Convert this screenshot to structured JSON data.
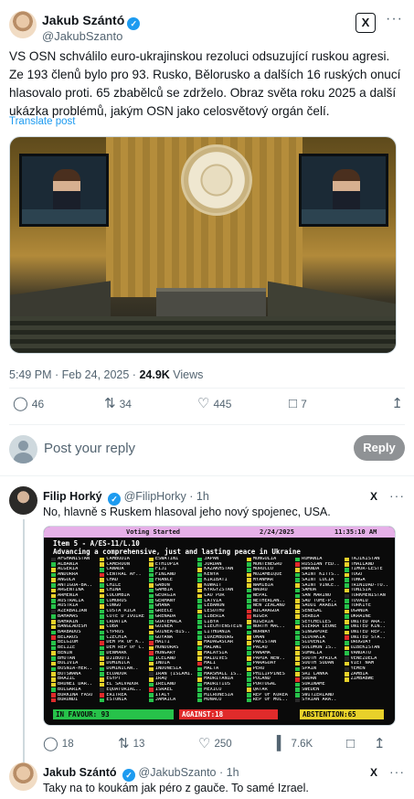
{
  "post": {
    "author_name": "Jakub Szántó",
    "author_handle": "@JakubSzanto",
    "grok_label": "X",
    "more_label": "···",
    "verified_mark": "✓",
    "text": "VS OSN schválilo euro-ukrajinskou rezoluci odsuzující ruskou agresi. Ze 193 členů bylo pro 93. Rusko, Bělorusko a dalších 16 ruských onucí hlasovalo proti. 65 zbabělců se zdrželo. Obraz světa roku 2025 a další ukázka problémů, jakým OSN jako celosvětový orgán čelí.",
    "translate_label": "Translate post",
    "time": "5:49 PM · Feb 24, 2025 ·",
    "views_count": "24.9K",
    "views_label": "Views",
    "stats": {
      "replies": "46",
      "reposts": "34",
      "likes": "445",
      "bookmarks": "7"
    }
  },
  "reply_box": {
    "placeholder": "Post your reply",
    "button_label": "Reply"
  },
  "replies": [
    {
      "author_name": "Filip Horký",
      "author_handle": "@FilipHorky · 1h",
      "text": "No, hlavně s Ruskem hlasoval jeho nový spojenec, USA.",
      "stats": {
        "replies": "18",
        "reposts": "13",
        "likes": "250",
        "views": "7.6K"
      }
    },
    {
      "author_name": "Jakub Szántó",
      "author_handle": "@JakubSzanto · 1h",
      "text": "Taky na to koukám jak péro z gauče. To samé Izrael."
    }
  ],
  "vote_board": {
    "header_status": "Voting Started",
    "header_date": "2/24/2025",
    "header_time": "11:35:10 AM",
    "item": "Item 5 - A/ES-11/L.10",
    "title": "Advancing a comprehensive, just and lasting peace in Ukraine",
    "in_favour": "IN FAVOUR: 93",
    "against": "AGAINST:18",
    "abstention": "ABSTENTION:65",
    "countries": [
      [
        "AFGHANISTAN",
        "n"
      ],
      [
        "ALBANIA",
        "g"
      ],
      [
        "ALGERIA",
        "y"
      ],
      [
        "ANDORRA",
        "g"
      ],
      [
        "ANGOLA",
        "y"
      ],
      [
        "ANTIGUA-BA..",
        "g"
      ],
      [
        "ARGENTINA",
        "y"
      ],
      [
        "ARMENIA",
        "y"
      ],
      [
        "AUSTRALIA",
        "g"
      ],
      [
        "AUSTRIA",
        "g"
      ],
      [
        "AZERBAIJAN",
        "n"
      ],
      [
        "BAHAMAS",
        "g"
      ],
      [
        "BAHRAIN",
        "y"
      ],
      [
        "BANGLADESH",
        "y"
      ],
      [
        "BARBADOS",
        "g"
      ],
      [
        "BELARUS",
        "r"
      ],
      [
        "BELGIUM",
        "g"
      ],
      [
        "BELIZE",
        "g"
      ],
      [
        "BENIN",
        "y"
      ],
      [
        "BHUTAN",
        "g"
      ],
      [
        "BOLIVIA",
        "y"
      ],
      [
        "BOSNIA-HER..",
        "g"
      ],
      [
        "BOTSWANA",
        "y"
      ],
      [
        "BRAZIL",
        "y"
      ],
      [
        "BRUNEI DAR..",
        "y"
      ],
      [
        "BULGARIA",
        "g"
      ],
      [
        "BURKINA FASO",
        "r"
      ],
      [
        "BURUNDI",
        "r"
      ],
      [
        "CAMBODIA",
        "y"
      ],
      [
        "CAMEROON",
        "y"
      ],
      [
        "CANADA",
        "g"
      ],
      [
        "CENTRAL AF..",
        "r"
      ],
      [
        "CHAD",
        "y"
      ],
      [
        "CHILE",
        "g"
      ],
      [
        "CHINA",
        "y"
      ],
      [
        "COLOMBIA",
        "y"
      ],
      [
        "COMOROS",
        "g"
      ],
      [
        "CONGO",
        "y"
      ],
      [
        "COSTA RICA",
        "g"
      ],
      [
        "COTE D'IVOIRE",
        "g"
      ],
      [
        "CROATIA",
        "g"
      ],
      [
        "CUBA",
        "y"
      ],
      [
        "CYPRUS",
        "g"
      ],
      [
        "CZECHIA",
        "g"
      ],
      [
        "DEM PR OF K..",
        "r"
      ],
      [
        "DEM REP OF C..",
        "g"
      ],
      [
        "DENMARK",
        "g"
      ],
      [
        "DJIBOUTI",
        "y"
      ],
      [
        "DOMINICA",
        "y"
      ],
      [
        "DOMINICAN..",
        "g"
      ],
      [
        "ECUADOR",
        "g"
      ],
      [
        "EGYPT",
        "y"
      ],
      [
        "EL SALVADOR",
        "y"
      ],
      [
        "EQUATORIAL..",
        "n"
      ],
      [
        "ERITREA",
        "r"
      ],
      [
        "ESTONIA",
        "g"
      ],
      [
        "ESWATINI",
        "y"
      ],
      [
        "ETHIOPIA",
        "y"
      ],
      [
        "FIJI",
        "g"
      ],
      [
        "FINLAND",
        "g"
      ],
      [
        "FRANCE",
        "g"
      ],
      [
        "GABON",
        "y"
      ],
      [
        "GAMBIA",
        "g"
      ],
      [
        "GEORGIA",
        "g"
      ],
      [
        "GERMANY",
        "g"
      ],
      [
        "GHANA",
        "g"
      ],
      [
        "GREECE",
        "g"
      ],
      [
        "GRENADA",
        "g"
      ],
      [
        "GUATEMALA",
        "g"
      ],
      [
        "GUINEA",
        "y"
      ],
      [
        "GUINEA-BIS..",
        "y"
      ],
      [
        "GUYANA",
        "g"
      ],
      [
        "HAITI",
        "r"
      ],
      [
        "HONDURAS",
        "y"
      ],
      [
        "HUNGARY",
        "r"
      ],
      [
        "ICELAND",
        "g"
      ],
      [
        "INDIA",
        "y"
      ],
      [
        "INDONESIA",
        "y"
      ],
      [
        "IRAN (ISLAMI..",
        "n"
      ],
      [
        "IRAQ",
        "y"
      ],
      [
        "IRELAND",
        "g"
      ],
      [
        "ISRAEL",
        "r"
      ],
      [
        "ITALY",
        "g"
      ],
      [
        "JAMAICA",
        "g"
      ],
      [
        "JAPAN",
        "g"
      ],
      [
        "JORDAN",
        "g"
      ],
      [
        "KAZAKHSTAN",
        "y"
      ],
      [
        "KENYA",
        "g"
      ],
      [
        "KIRIBATI",
        "g"
      ],
      [
        "KUWAIT",
        "y"
      ],
      [
        "KYRGYZSTAN",
        "y"
      ],
      [
        "LAO PDR",
        "y"
      ],
      [
        "LATVIA",
        "g"
      ],
      [
        "LEBANON",
        "g"
      ],
      [
        "LESOTHO",
        "y"
      ],
      [
        "LIBERIA",
        "g"
      ],
      [
        "LIBYA",
        "g"
      ],
      [
        "LIECHTENSTEIN",
        "g"
      ],
      [
        "LITHUANIA",
        "g"
      ],
      [
        "LUXEMBOURG",
        "g"
      ],
      [
        "MADAGASCAR",
        "y"
      ],
      [
        "MALAWI",
        "g"
      ],
      [
        "MALAYSIA",
        "y"
      ],
      [
        "MALDIVES",
        "y"
      ],
      [
        "MALI",
        "r"
      ],
      [
        "MALTA",
        "g"
      ],
      [
        "MARSHALL IS..",
        "g"
      ],
      [
        "MAURITANIA",
        "y"
      ],
      [
        "MAURITIUS",
        "g"
      ],
      [
        "MEXICO",
        "g"
      ],
      [
        "MICRONESIA",
        "g"
      ],
      [
        "MONACO",
        "g"
      ],
      [
        "MONGOLIA",
        "y"
      ],
      [
        "MONTENEGRO",
        "g"
      ],
      [
        "MOROCCO",
        "g"
      ],
      [
        "MOZAMBIQUE",
        "y"
      ],
      [
        "MYANMAR",
        "y"
      ],
      [
        "NAMIBIA",
        "y"
      ],
      [
        "NAURU",
        "g"
      ],
      [
        "NEPAL",
        "g"
      ],
      [
        "NETHERLAN..",
        "g"
      ],
      [
        "NEW ZEALAND",
        "g"
      ],
      [
        "NICARAGUA",
        "r"
      ],
      [
        "NIGER",
        "r"
      ],
      [
        "NIGERIA",
        "y"
      ],
      [
        "NORTH MAC..",
        "g"
      ],
      [
        "NORWAY",
        "g"
      ],
      [
        "OMAN",
        "y"
      ],
      [
        "PAKISTAN",
        "y"
      ],
      [
        "PALAU",
        "g"
      ],
      [
        "PANAMA",
        "g"
      ],
      [
        "PAPUA NEW..",
        "y"
      ],
      [
        "PARAGUAY",
        "g"
      ],
      [
        "PERU",
        "y"
      ],
      [
        "PHILIPPINES",
        "g"
      ],
      [
        "POLAND",
        "g"
      ],
      [
        "PORTUGAL",
        "g"
      ],
      [
        "QATAR",
        "y"
      ],
      [
        "REP OF KOREA",
        "g"
      ],
      [
        "REP OF MOL..",
        "g"
      ],
      [
        "ROMANIA",
        "g"
      ],
      [
        "RUSSIAN FED..",
        "r"
      ],
      [
        "RWANDA",
        "y"
      ],
      [
        "SAINT KITTS..",
        "g"
      ],
      [
        "SAINT LUCIA",
        "g"
      ],
      [
        "SAINT VINCE..",
        "y"
      ],
      [
        "SAMOA",
        "g"
      ],
      [
        "SAN MARINO",
        "g"
      ],
      [
        "SAO TOME-P..",
        "y"
      ],
      [
        "SAUDI ARABIA",
        "y"
      ],
      [
        "SENEGAL",
        "y"
      ],
      [
        "SERBIA",
        "y"
      ],
      [
        "SEYCHELLES",
        "g"
      ],
      [
        "SIERRA LEONE",
        "y"
      ],
      [
        "SINGAPORE",
        "g"
      ],
      [
        "SLOVAKIA",
        "g"
      ],
      [
        "SLOVENIA",
        "g"
      ],
      [
        "SOLOMON IS..",
        "y"
      ],
      [
        "SOMALIA",
        "y"
      ],
      [
        "SOUTH AFRICA",
        "y"
      ],
      [
        "SOUTH SUDAN",
        "y"
      ],
      [
        "SPAIN",
        "g"
      ],
      [
        "SRI LANKA",
        "y"
      ],
      [
        "SUDAN",
        "r"
      ],
      [
        "SURINAME",
        "g"
      ],
      [
        "SWEDEN",
        "g"
      ],
      [
        "SWITZERLAND",
        "g"
      ],
      [
        "SYRIAN ARA..",
        "n"
      ],
      [
        "TAJIKISTAN",
        "y"
      ],
      [
        "THAILAND",
        "y"
      ],
      [
        "TIMOR-LESTE",
        "g"
      ],
      [
        "TOGO",
        "y"
      ],
      [
        "TONGA",
        "g"
      ],
      [
        "TRINIDAD-TO..",
        "g"
      ],
      [
        "TUNISIA",
        "y"
      ],
      [
        "TURKMENISTAN",
        "n"
      ],
      [
        "TUVALU",
        "g"
      ],
      [
        "TÜRKIYE",
        "g"
      ],
      [
        "UGANDA",
        "y"
      ],
      [
        "UKRAINE",
        "g"
      ],
      [
        "UNITED ARA..",
        "y"
      ],
      [
        "UNITED KIN..",
        "g"
      ],
      [
        "UNITED REP..",
        "y"
      ],
      [
        "UNITED STA..",
        "r"
      ],
      [
        "URUGUAY",
        "g"
      ],
      [
        "UZBEKISTAN",
        "y"
      ],
      [
        "VANUATU",
        "g"
      ],
      [
        "VENEZUELA",
        "n"
      ],
      [
        "VIET NAM",
        "y"
      ],
      [
        "YEMEN",
        "n"
      ],
      [
        "ZAMBIA",
        "y"
      ],
      [
        "ZIMBABWE",
        "y"
      ]
    ]
  },
  "colors": {
    "accent": "#1d9bf0",
    "reply_button": "#8f9295",
    "favour": "#27c24a",
    "against": "#e02b2b",
    "abstention": "#e8d12a",
    "board_header": "#e6b0e8"
  }
}
